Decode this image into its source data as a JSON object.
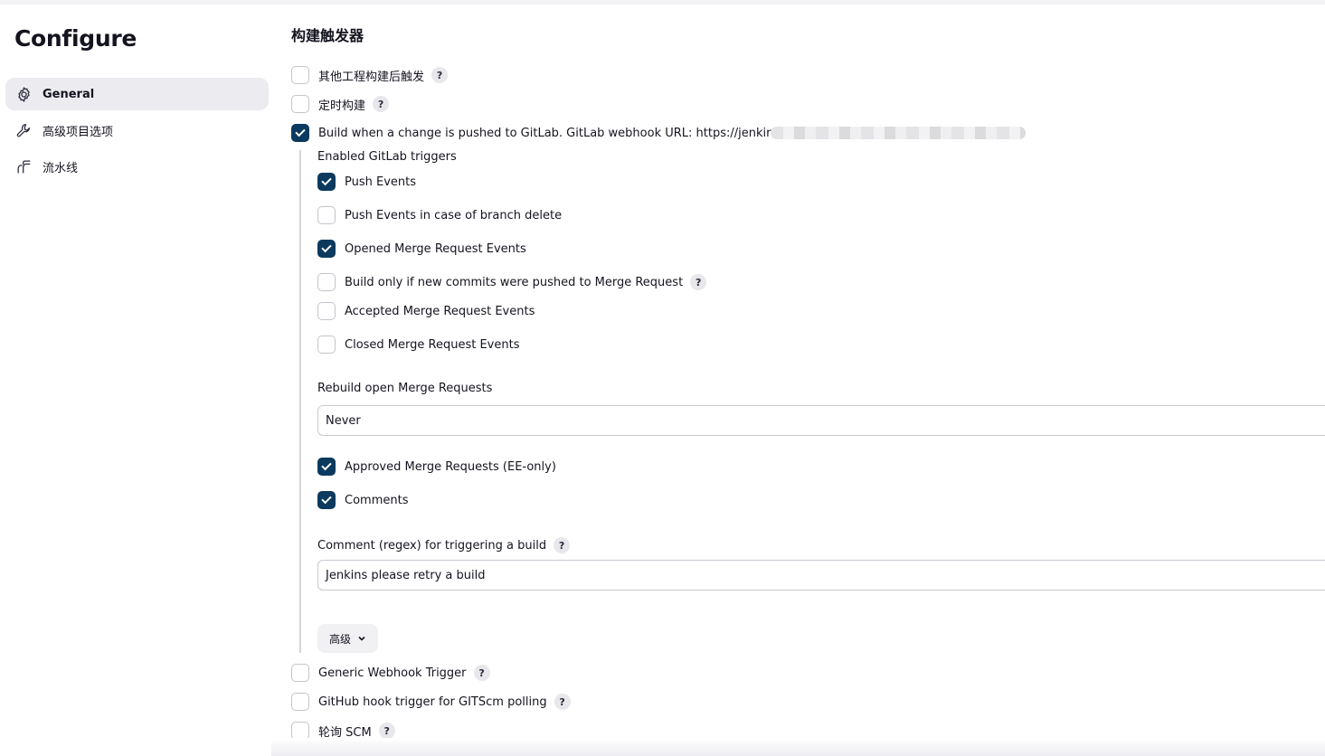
{
  "sidebar": {
    "title": "Configure",
    "items": [
      {
        "label": "General",
        "icon": "gear-icon",
        "active": true
      },
      {
        "label": "高级项目选项",
        "icon": "wrench-icon",
        "active": false
      },
      {
        "label": "流水线",
        "icon": "pipeline-icon",
        "active": false
      }
    ]
  },
  "main": {
    "section_title": "构建触发器",
    "triggers": {
      "other_project": {
        "label": "其他工程构建后触发",
        "checked": false,
        "help": "?"
      },
      "scheduled": {
        "label": "定时构建",
        "checked": false,
        "help": "?"
      },
      "gitlab": {
        "label": "Build when a change is pushed to GitLab. GitLab webhook URL: https://jenkir",
        "checked": true
      }
    },
    "gitlab_options": {
      "enabled_triggers_label": "Enabled GitLab triggers",
      "push_events": {
        "label": "Push Events",
        "checked": true
      },
      "push_branch_delete": {
        "label": "Push Events in case of branch delete",
        "checked": false
      },
      "opened_mr": {
        "label": "Opened Merge Request Events",
        "checked": true
      },
      "new_commits_only": {
        "label": "Build only if new commits were pushed to Merge Request",
        "checked": false,
        "help": "?"
      },
      "accepted_mr": {
        "label": "Accepted Merge Request Events",
        "checked": false
      },
      "closed_mr": {
        "label": "Closed Merge Request Events",
        "checked": false
      },
      "rebuild_label": "Rebuild open Merge Requests",
      "rebuild_value": "Never",
      "approved_mr": {
        "label": "Approved Merge Requests (EE-only)",
        "checked": true
      },
      "comments": {
        "label": "Comments",
        "checked": true
      },
      "comment_regex_label": "Comment (regex) for triggering a build",
      "comment_regex_help": "?",
      "comment_regex_value": "Jenkins please retry a build",
      "advanced_label": "高级"
    },
    "more_triggers": {
      "generic_webhook": {
        "label": "Generic Webhook Trigger",
        "checked": false,
        "help": "?"
      },
      "github_hook": {
        "label": "GitHub hook trigger for GITScm polling",
        "checked": false,
        "help": "?"
      },
      "poll_scm": {
        "label": "轮询 SCM",
        "checked": false,
        "help": "?"
      }
    }
  },
  "colors": {
    "checkbox_checked": "#0b3a5e",
    "active_nav_bg": "#ebebf0"
  }
}
